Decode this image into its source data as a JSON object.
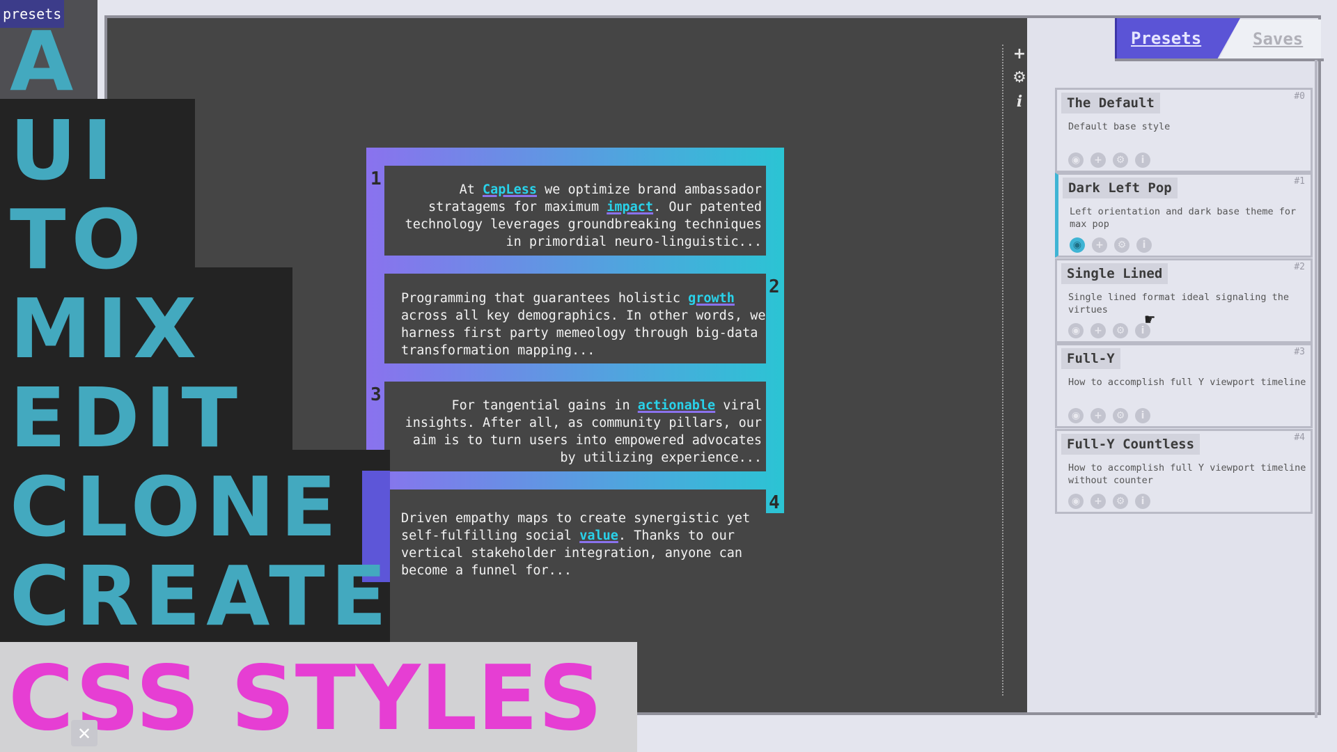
{
  "rail": {
    "tag": "presets",
    "icons": [
      "pencil-icon",
      "save-icon",
      "sliders-icon"
    ]
  },
  "editor": {
    "tools": [
      {
        "icon": "plus-icon",
        "glyph": "+"
      },
      {
        "icon": "gear-icon",
        "glyph": "⚙"
      },
      {
        "icon": "info-icon",
        "glyph": "i"
      }
    ]
  },
  "preview": {
    "items": [
      {
        "n": "1",
        "segments": [
          {
            "t": "At "
          },
          {
            "t": "CapLess",
            "hl": true
          },
          {
            "t": " we optimize brand ambassador stratagems for maximum "
          },
          {
            "t": "impact",
            "hl": true
          },
          {
            "t": ". Our patented technology leverages groundbreaking techniques in primordial neuro-linguistic..."
          }
        ]
      },
      {
        "n": "2",
        "segments": [
          {
            "t": "Programming that guarantees holistic "
          },
          {
            "t": "growth",
            "hl": true
          },
          {
            "t": " across all key demographics. In other words, we harness first party memeology through big-data transformation mapping..."
          }
        ]
      },
      {
        "n": "3",
        "segments": [
          {
            "t": "For tangential gains in "
          },
          {
            "t": "actionable",
            "hl": true
          },
          {
            "t": " viral insights. After all, as community pillars, our aim is to turn users into empowered advocates by utilizing experience..."
          }
        ]
      },
      {
        "n": "4",
        "segments": [
          {
            "t": "Driven empathy maps to create synergistic yet self-fulfilling social "
          },
          {
            "t": "value",
            "hl": true
          },
          {
            "t": ". Thanks to our vertical stakeholder integration, anyone can become a funnel for..."
          }
        ]
      }
    ]
  },
  "panel": {
    "tabs": {
      "presets": "Presets",
      "saves": "Saves"
    },
    "cards": [
      {
        "title": "The Default",
        "idx": "#0",
        "desc": "Default base style",
        "active": false
      },
      {
        "title": "Dark Left Pop",
        "idx": "#1",
        "desc": "Left orientation and dark base theme for max pop",
        "active": true
      },
      {
        "title": "Single Lined",
        "idx": "#2",
        "desc": "Single lined format ideal signaling the virtues",
        "active": false
      },
      {
        "title": "Full-Y",
        "idx": "#3",
        "desc": "How to accomplish full Y viewport timeline",
        "active": false
      },
      {
        "title": "Full-Y Countless",
        "idx": "#4",
        "desc": "How to accomplish full Y viewport timeline without counter",
        "active": false
      }
    ],
    "card_actions": [
      {
        "icon": "eye-icon",
        "glyph": "◉"
      },
      {
        "icon": "plus-icon",
        "glyph": "+"
      },
      {
        "icon": "gear-icon",
        "glyph": "⚙"
      },
      {
        "icon": "info-icon",
        "glyph": "i"
      }
    ]
  },
  "overlay": {
    "words": [
      "A",
      "UI",
      "TO",
      "MIX",
      "EDIT",
      "CLONE",
      "CREATE"
    ],
    "headline": "CSS STYLES",
    "colors": {
      "words": "#43a9bf",
      "headline": "#e63ed3"
    }
  }
}
